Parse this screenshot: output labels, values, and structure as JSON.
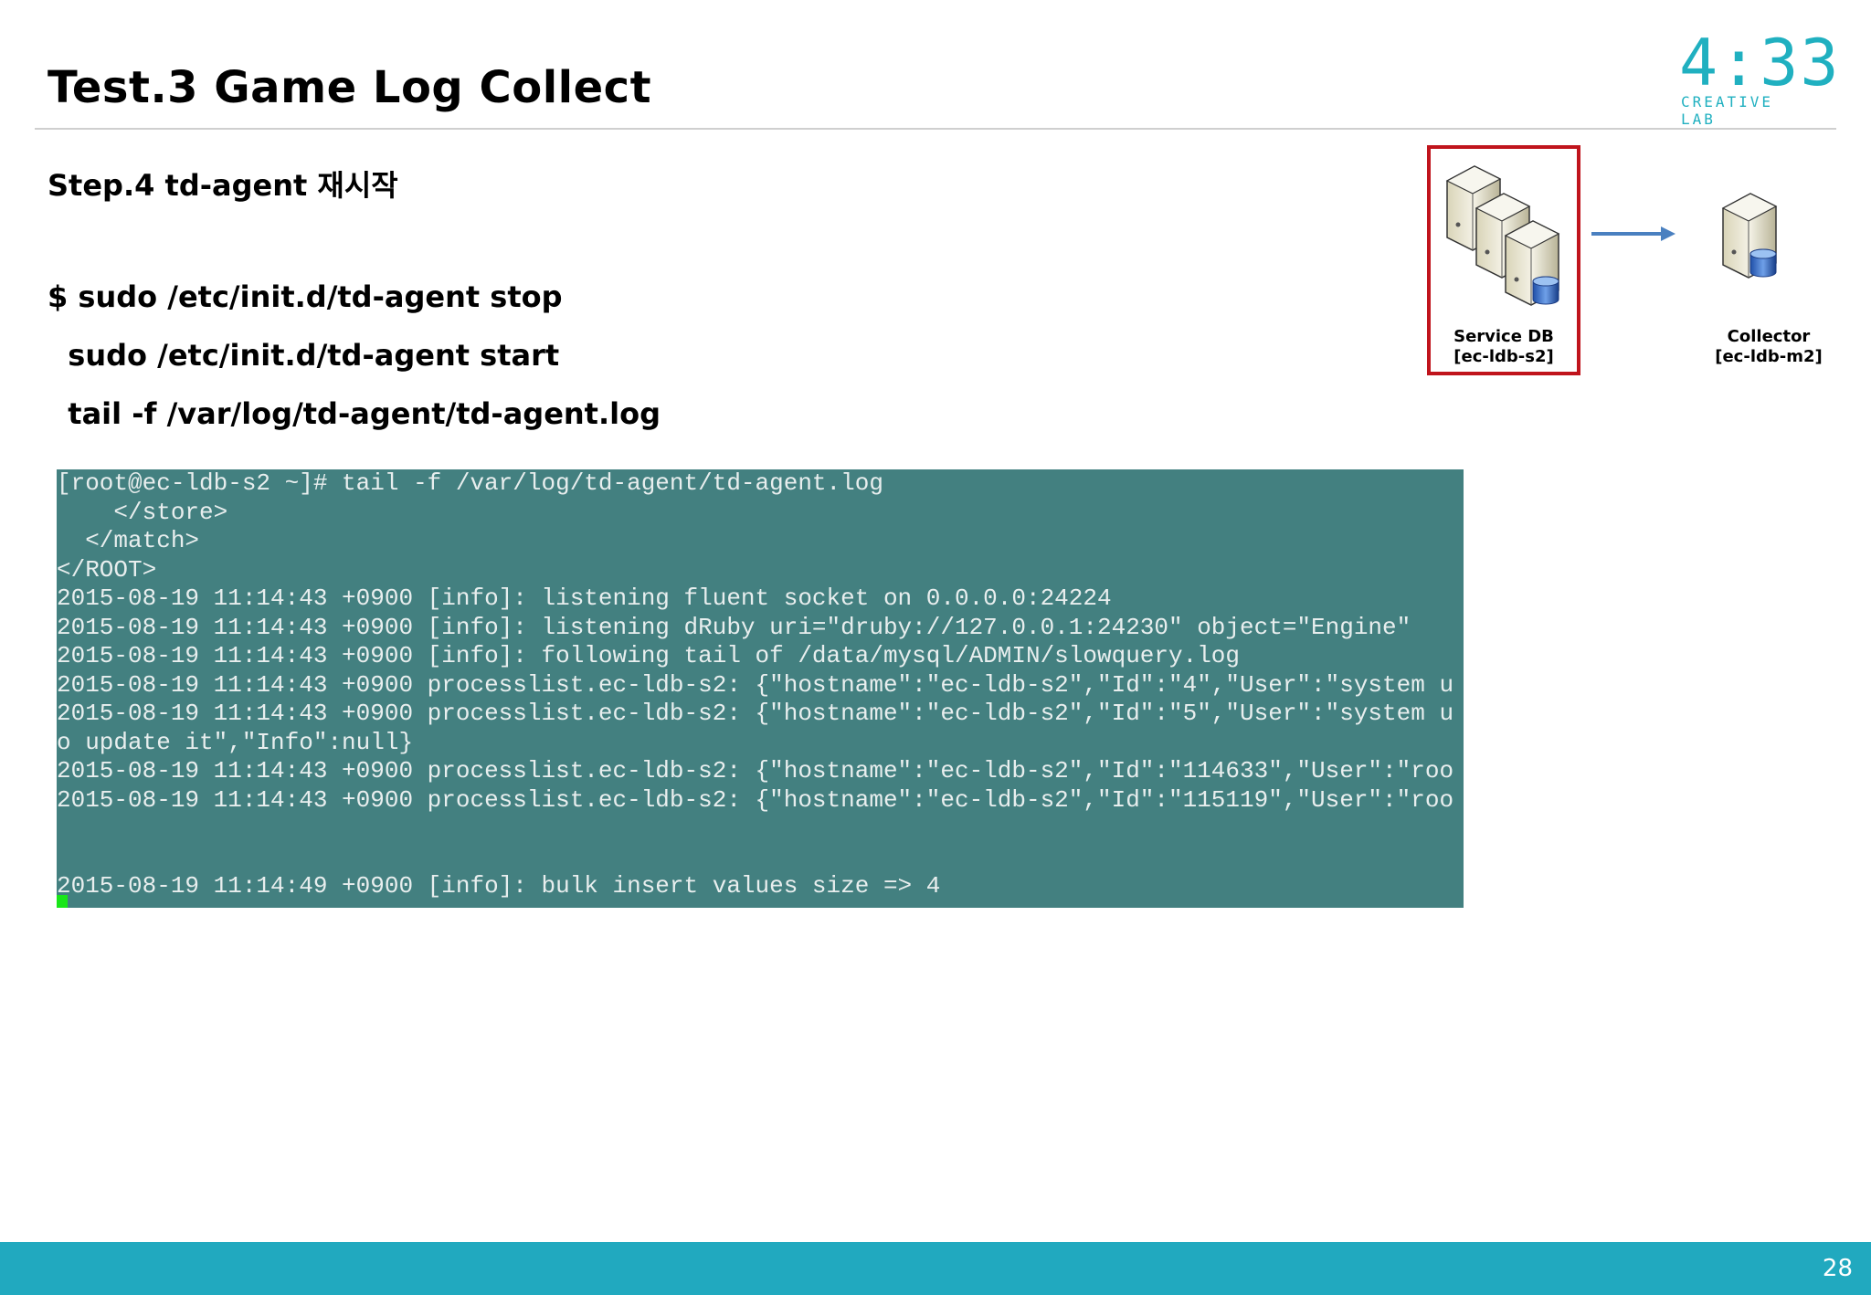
{
  "slide": {
    "title": "Test.3 Game Log Collect",
    "page_number": "28"
  },
  "logo": {
    "digits": "4:33",
    "subtitle": "CREATIVE LAB"
  },
  "step": {
    "label": "Step.4 td-agent 재시작"
  },
  "commands": [
    "$ sudo /etc/init.d/td-agent stop",
    "  sudo /etc/init.d/td-agent start",
    "  tail -f /var/log/td-agent/td-agent.log"
  ],
  "terminal": {
    "lines": [
      "[root@ec-ldb-s2 ~]# tail -f /var/log/td-agent/td-agent.log",
      "    </store>",
      "  </match>",
      "</ROOT>",
      "2015-08-19 11:14:43 +0900 [info]: listening fluent socket on 0.0.0.0:24224",
      "2015-08-19 11:14:43 +0900 [info]: listening dRuby uri=\"druby://127.0.0.1:24230\" object=\"Engine\"",
      "2015-08-19 11:14:43 +0900 [info]: following tail of /data/mysql/ADMIN/slowquery.log",
      "2015-08-19 11:14:43 +0900 processlist.ec-ldb-s2: {\"hostname\":\"ec-ldb-s2\",\"Id\":\"4\",\"User\":\"system u",
      "2015-08-19 11:14:43 +0900 processlist.ec-ldb-s2: {\"hostname\":\"ec-ldb-s2\",\"Id\":\"5\",\"User\":\"system u",
      "o update it\",\"Info\":null}",
      "2015-08-19 11:14:43 +0900 processlist.ec-ldb-s2: {\"hostname\":\"ec-ldb-s2\",\"Id\":\"114633\",\"User\":\"roo",
      "2015-08-19 11:14:43 +0900 processlist.ec-ldb-s2: {\"hostname\":\"ec-ldb-s2\",\"Id\":\"115119\",\"User\":\"roo",
      "",
      "",
      "2015-08-19 11:14:49 +0900 [info]: bulk insert values size => 4"
    ],
    "background": "#438080",
    "cursor_color": "#19e619"
  },
  "diagram": {
    "service_db": {
      "name": "Service DB",
      "host": "[ec-ldb-s2]"
    },
    "collector": {
      "name": "Collector",
      "host": "[ec-ldb-m2]"
    },
    "highlight_color": "#c0141c",
    "arrow_color": "#4a80c0"
  },
  "colors": {
    "footer": "#21a9bf",
    "logo": "#20b0c0"
  }
}
